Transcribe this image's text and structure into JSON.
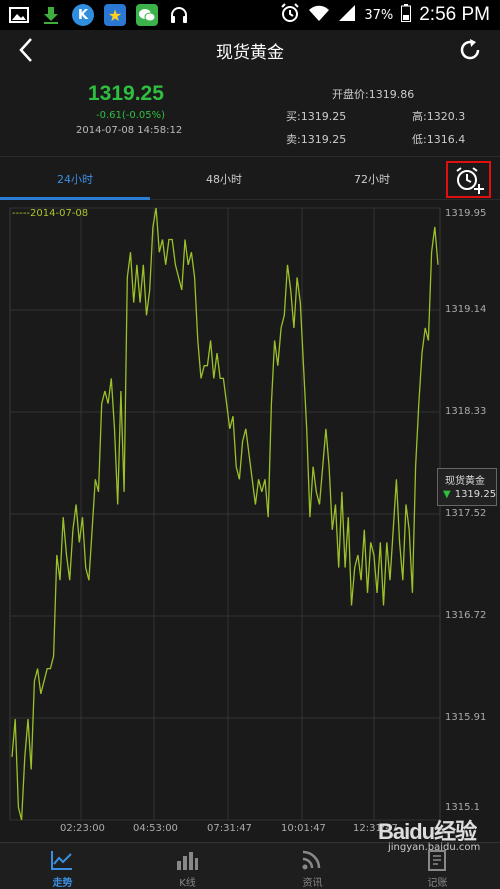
{
  "statusbar": {
    "battery": "37%",
    "time": "2:56 PM",
    "icons": [
      "image-icon",
      "download-arrow-icon",
      "k-app-icon",
      "star-app-icon",
      "wechat-icon",
      "headphones-icon",
      "alarm-icon",
      "wifi-icon",
      "signal-icon",
      "battery-icon"
    ]
  },
  "header": {
    "title": "现货黄金"
  },
  "quote": {
    "price": "1319.25",
    "change": "-0.61(-0.05%)",
    "timestamp": "2014-07-08 14:58:12",
    "open": "开盘价:1319.86",
    "buy": "买:1319.25",
    "high": "高:1320.3",
    "sell": "卖:1319.25",
    "low": "低:1316.4"
  },
  "tabs": [
    {
      "label": "24小时",
      "active": true
    },
    {
      "label": "48小时",
      "active": false
    },
    {
      "label": "72小时",
      "active": false
    }
  ],
  "chart_data": {
    "type": "line",
    "legend": "-----2014-07-08",
    "y_ticks": [
      "1319.95",
      "1319.14",
      "1318.33",
      "1317.52",
      "1316.72",
      "1315.91",
      "1315.1"
    ],
    "x_ticks": [
      "02:23:00",
      "04:53:00",
      "07:31:47",
      "10:01:47",
      "12:31:47"
    ],
    "ylim": [
      1315.1,
      1319.95
    ],
    "color": "#9bc12a",
    "tooltip": {
      "name": "现货黄金",
      "value": "1319.25"
    },
    "series": [
      {
        "values": [
          1315.6,
          1315.9,
          1315.2,
          1315.1,
          1315.6,
          1315.9,
          1315.5,
          1316.2,
          1316.3,
          1316.1,
          1316.2,
          1316.3,
          1316.3,
          1316.4,
          1317.2,
          1317.0,
          1317.5,
          1317.2,
          1317.0,
          1317.4,
          1317.6,
          1317.3,
          1317.5,
          1317.1,
          1317.0,
          1317.4,
          1317.8,
          1317.7,
          1318.4,
          1318.5,
          1318.4,
          1318.6,
          1318.2,
          1317.6,
          1318.5,
          1317.7,
          1319.4,
          1319.6,
          1319.2,
          1319.5,
          1319.2,
          1319.5,
          1319.1,
          1319.3,
          1319.8,
          1319.95,
          1319.6,
          1319.7,
          1319.5,
          1319.7,
          1319.7,
          1319.5,
          1319.4,
          1319.3,
          1319.7,
          1319.5,
          1319.6,
          1319.4,
          1318.9,
          1318.6,
          1318.7,
          1318.7,
          1318.9,
          1318.6,
          1318.8,
          1318.6,
          1318.6,
          1318.4,
          1318.2,
          1318.3,
          1317.9,
          1317.8,
          1318.1,
          1318.2,
          1318.0,
          1317.8,
          1317.6,
          1317.8,
          1317.7,
          1317.8,
          1317.5,
          1318.4,
          1318.9,
          1318.7,
          1319.0,
          1319.1,
          1319.5,
          1319.3,
          1319.0,
          1319.4,
          1319.2,
          1318.7,
          1318.2,
          1317.5,
          1317.9,
          1317.7,
          1317.6,
          1317.9,
          1318.2,
          1317.9,
          1317.4,
          1317.6,
          1317.1,
          1317.7,
          1317.1,
          1317.5,
          1316.8,
          1317.1,
          1317.2,
          1317.0,
          1317.4,
          1316.9,
          1317.3,
          1317.2,
          1316.9,
          1317.3,
          1316.8,
          1317.3,
          1317.0,
          1317.4,
          1317.8,
          1317.3,
          1317.0,
          1317.6,
          1317.4,
          1316.9,
          1317.9,
          1318.4,
          1318.8,
          1319.0,
          1318.9,
          1319.6,
          1319.8,
          1319.5
        ]
      }
    ]
  },
  "bottom_nav": [
    {
      "label": "走势",
      "icon": "line-chart-icon",
      "active": true
    },
    {
      "label": "K线",
      "icon": "bar-chart-icon",
      "active": false
    },
    {
      "label": "资讯",
      "icon": "rss-icon",
      "active": false
    },
    {
      "label": "记账",
      "icon": "notebook-icon",
      "active": false
    }
  ],
  "watermark": {
    "brand": "Baidu经验",
    "site": "jingyan.baidu.com"
  }
}
